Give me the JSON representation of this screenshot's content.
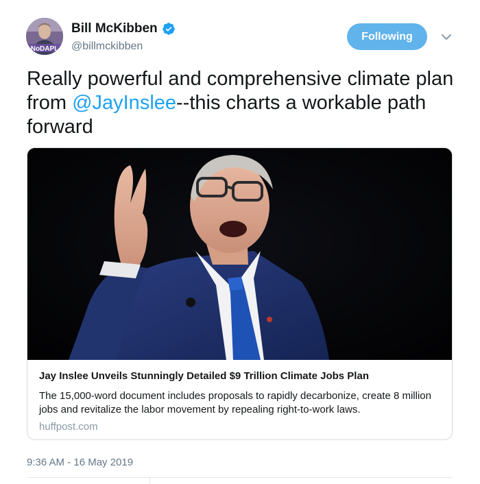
{
  "author": {
    "display_name": "Bill McKibben",
    "handle": "@billmckibben",
    "avatar_badge": "NoDAPL",
    "verified": true
  },
  "follow_button": {
    "label": "Following"
  },
  "menu": {
    "icon": "chevron-down-icon"
  },
  "tweet": {
    "text_before": "Really powerful and comprehensive climate plan from ",
    "mention": "@JayInslee",
    "text_after": "--this charts a workable path forward"
  },
  "card": {
    "title": "Jay Inslee Unveils Stunningly Detailed $9 Trillion Climate Jobs Plan",
    "description": "The 15,000-word document includes proposals to rapidly decarbonize, create 8 million jobs and revitalize the labor movement by repealing right-to-work laws.",
    "domain": "huffpost.com"
  },
  "timestamp": "9:36 AM - 16 May 2019",
  "colors": {
    "accent": "#1da1f2",
    "follow_button": "#60b3eb",
    "secondary_text": "#657786"
  }
}
